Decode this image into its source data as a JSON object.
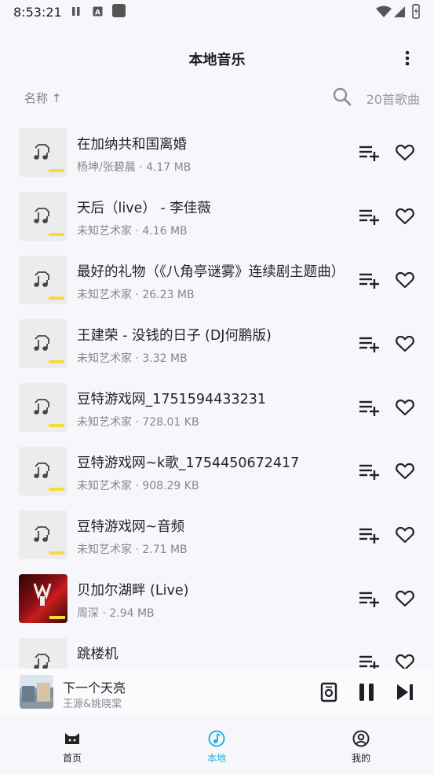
{
  "status_bar": {
    "time": "8:53:21"
  },
  "header": {
    "title": "本地音乐"
  },
  "toolbar": {
    "sort_label": "名称 ↑",
    "count_label": "20首歌曲"
  },
  "songs": [
    {
      "title": "在加纳共和国离婚",
      "subtitle": "杨坤/张碧晨 · 4.17 MB",
      "cover": "placeholder"
    },
    {
      "title": "天后（live） - 李佳薇",
      "subtitle": "未知艺术家 · 4.16 MB",
      "cover": "placeholder"
    },
    {
      "title": "最好的礼物（《八角亭谜雾》连续剧主题曲）",
      "subtitle": "未知艺术家 · 26.23 MB",
      "cover": "placeholder"
    },
    {
      "title": "王建荣 - 没钱的日子 (DJ何鹏版)",
      "subtitle": "未知艺术家 · 3.32 MB",
      "cover": "placeholder"
    },
    {
      "title": "豆特游戏网_1751594433231",
      "subtitle": "未知艺术家 · 728.01 KB",
      "cover": "placeholder"
    },
    {
      "title": "豆特游戏网~k歌_1754450672417",
      "subtitle": "未知艺术家 · 908.29 KB",
      "cover": "placeholder"
    },
    {
      "title": "豆特游戏网~音频",
      "subtitle": "未知艺术家 · 2.71 MB",
      "cover": "placeholder"
    },
    {
      "title": "贝加尔湖畔 (Live)",
      "subtitle": "周深 · 2.94 MB",
      "cover": "album-art"
    },
    {
      "title": "跳楼机",
      "subtitle": "",
      "cover": "placeholder"
    }
  ],
  "now_playing": {
    "title": "下一个天亮",
    "artist": "王源&姚晓棠"
  },
  "bottom_nav": [
    {
      "label": "首页",
      "icon": "cat-icon",
      "active": false
    },
    {
      "label": "本地",
      "icon": "music-note-icon",
      "active": true
    },
    {
      "label": "我的",
      "icon": "profile-icon",
      "active": false
    }
  ],
  "colors": {
    "accent": "#21b2e0",
    "cover_bar": "#f6dc3b",
    "background": "#f7f7fb"
  }
}
